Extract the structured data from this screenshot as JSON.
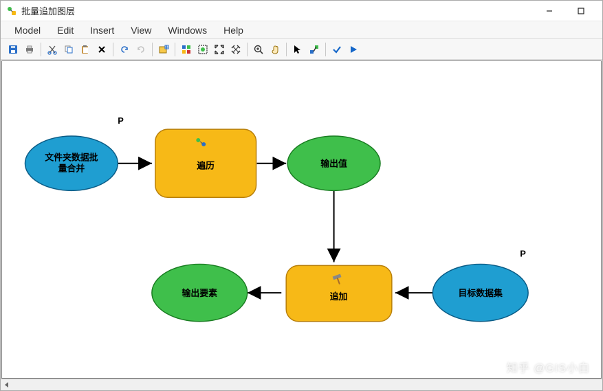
{
  "window": {
    "title": "批量追加图层",
    "minimize": "−",
    "maximize": "□",
    "close": "×"
  },
  "menu": {
    "model": "Model",
    "edit": "Edit",
    "insert": "Insert",
    "view": "View",
    "windows": "Windows",
    "help": "Help"
  },
  "toolbar": {
    "save": "save-icon",
    "print": "print-icon",
    "cut": "cut-icon",
    "copy": "copy-icon",
    "paste": "paste-icon",
    "delete": "delete-icon",
    "undo": "undo-icon",
    "redo": "redo-icon",
    "addData": "add-data-icon",
    "autoLayout": "auto-layout-icon",
    "fullExtent": "full-extent-icon",
    "zoomIn": "fixed-zoom-in-icon",
    "zoomOut": "fixed-zoom-out-icon",
    "intZoomIn": "zoom-in-icon",
    "pan": "pan-icon",
    "select": "select-icon",
    "connect": "connect-icon",
    "validate": "validate-icon",
    "run": "run-icon"
  },
  "nodes": {
    "sourceData": {
      "label1": "文件夹数据批",
      "label2": "量合并"
    },
    "iterate": {
      "label": "遍历",
      "paramFlag": "P"
    },
    "outputValue": {
      "label": "输出值"
    },
    "append": {
      "label": "追加"
    },
    "target": {
      "label": "目标数据集",
      "paramFlag": "P"
    },
    "outputFeature": {
      "label": "输出要素"
    }
  },
  "colors": {
    "blueFill": "#1f9ed1",
    "blueStroke": "#0b5c86",
    "greenFill": "#3fbf4b",
    "greenStroke": "#1a7d22",
    "yellowFill": "#f7b917",
    "yellowStroke": "#b87f0a",
    "arrow": "#000"
  },
  "watermark": "知乎 @GIS小白"
}
